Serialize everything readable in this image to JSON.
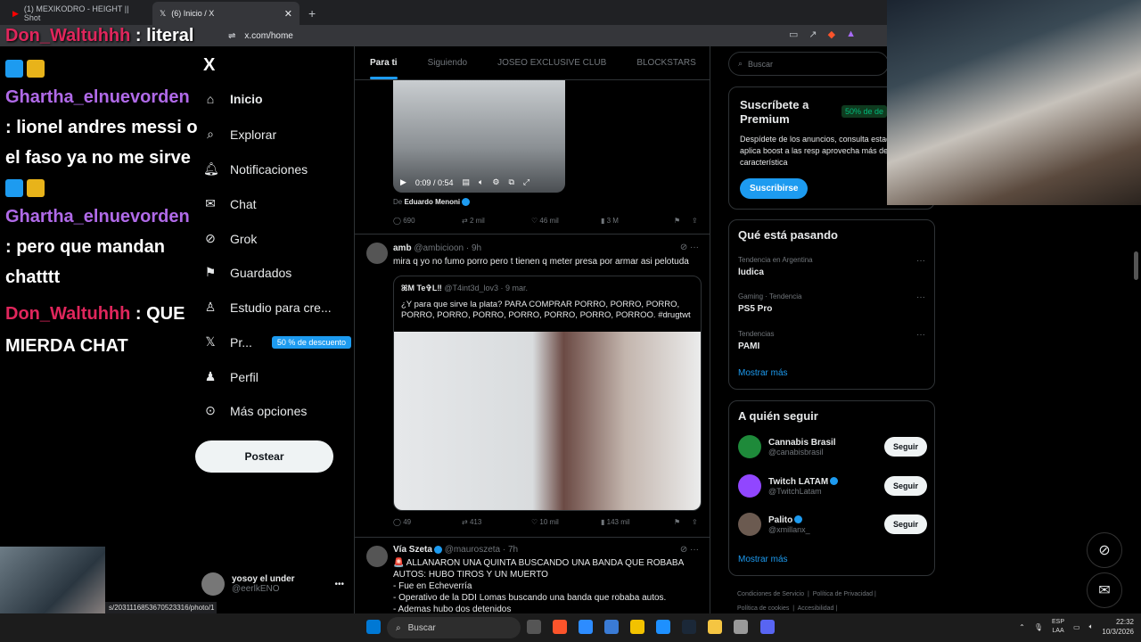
{
  "browser": {
    "tabs": [
      {
        "label": "(1) MEXIKODRO - HEIGHT || Shot",
        "active": false
      },
      {
        "label": "(6) Inicio / X",
        "active": true
      }
    ],
    "url": "x.com/home",
    "status_url": "s/2031116853670523316/photo/1"
  },
  "chat": {
    "messages": [
      {
        "user": "Don_Waltuhhh",
        "text": ": literal"
      },
      {
        "user": "Ghartha_elnuevorden",
        "text": ": lionel andres messi o el faso ya no me sirve"
      },
      {
        "user": "Ghartha_elnuevorden",
        "text": ": pero que mandan chatttt"
      },
      {
        "user": "Don_Waltuhhh",
        "text": ": QUE MIERDA CHAT"
      }
    ]
  },
  "nav": {
    "logo": "X",
    "items": [
      {
        "label": "Inicio",
        "icon": "home-icon"
      },
      {
        "label": "Explorar",
        "icon": "search-icon"
      },
      {
        "label": "Notificaciones",
        "icon": "bell-icon"
      },
      {
        "label": "Chat",
        "icon": "mail-icon"
      },
      {
        "label": "Grok",
        "icon": "grok-icon"
      },
      {
        "label": "Guardados",
        "icon": "bookmark-icon"
      },
      {
        "label": "Estudio para cre...",
        "icon": "studio-icon"
      },
      {
        "label": "Pr...",
        "icon": "x-premium-icon",
        "badge": "50 % de descuento"
      },
      {
        "label": "Perfil",
        "icon": "person-icon"
      },
      {
        "label": "Más opciones",
        "icon": "more-circle-icon"
      }
    ],
    "post_button": "Postear",
    "account": {
      "name": "yosoy el under",
      "handle": "@eerlkENO"
    }
  },
  "feed": {
    "tabs": [
      "Para ti",
      "Siguiendo",
      "JOSEO EXCLUSIVE CLUB",
      "BLOCKSTARS"
    ],
    "video": {
      "time": "0:09 / 0:54",
      "from_prefix": "De",
      "from_name": "Eduardo Menoni"
    },
    "tweet0_actions": {
      "replies": "690",
      "reposts": "2 mil",
      "likes": "46 mil",
      "views": "3 M"
    },
    "tweet1": {
      "name": "amb",
      "handle": "@ambicioon · 9h",
      "text": "mira q yo no fumo porro pero t tienen q meter presa por armar asi pelotuda",
      "quote": {
        "name": "ꕤM    Te✞L‼",
        "handle": "@T4int3d_lov3 · 9 mar.",
        "text": "¿Y para que sirve la plata? PARA COMPRAR PORRO, PORRO, PORRO, PORRO, PORRO, PORRO, PORRO, PORRO, PORRO, PORROO. #drugtwt"
      },
      "actions": {
        "replies": "49",
        "reposts": "413",
        "likes": "10 mil",
        "views": "143 mil"
      }
    },
    "tweet2": {
      "name": "Vía Szeta",
      "handle": "@mauroszeta · 7h",
      "lines": [
        "🚨 ALLANARON UNA QUINTA BUSCANDO UNA BANDA QUE ROBABA AUTOS: HUBO TIROS Y UN MUERTO",
        "- Fue en Echeverría",
        "- Operativo de la DDI Lomas buscando una banda que robaba autos.",
        "- Ademas hubo dos detenidos"
      ]
    }
  },
  "sidebar": {
    "search_placeholder": "Buscar",
    "premium": {
      "title": "Suscríbete a Premium",
      "badge": "50% de de",
      "text": "Despídete de los anuncios, consulta estadísticas, aplica boost a las resp aprovecha más de 20 característica",
      "button": "Suscribirse"
    },
    "trends": {
      "title": "Qué está pasando",
      "items": [
        {
          "context": "Tendencia en Argentina",
          "name": "ludica"
        },
        {
          "context": "Gaming · Tendencia",
          "name": "PS5 Pro"
        },
        {
          "context": "Tendencias",
          "name": "PAMI"
        }
      ],
      "show_more": "Mostrar más"
    },
    "follow": {
      "title": "A quién seguir",
      "items": [
        {
          "name": "Cannabis Brasil",
          "handle": "@canabisbrasil",
          "verified": false,
          "button": "Seguir"
        },
        {
          "name": "Twitch LATAM",
          "handle": "@TwitchLatam",
          "verified": true,
          "button": "Seguir"
        },
        {
          "name": "Palito",
          "handle": "@xmillanx_",
          "verified": true,
          "button": "Seguir"
        }
      ],
      "show_more": "Mostrar más"
    },
    "footer": [
      "Condiciones de Servicio",
      "Política de Privacidad",
      "Política de cookies",
      "Accesibilidad"
    ]
  },
  "taskbar": {
    "search": "Buscar",
    "lang": [
      "ESP",
      "LAA"
    ],
    "time": "22:32",
    "date": "10/3/2026"
  },
  "colors": {
    "accent": "#1d9bf0",
    "chat_user1": "#e0265c",
    "chat_user2": "#b06ae8"
  }
}
